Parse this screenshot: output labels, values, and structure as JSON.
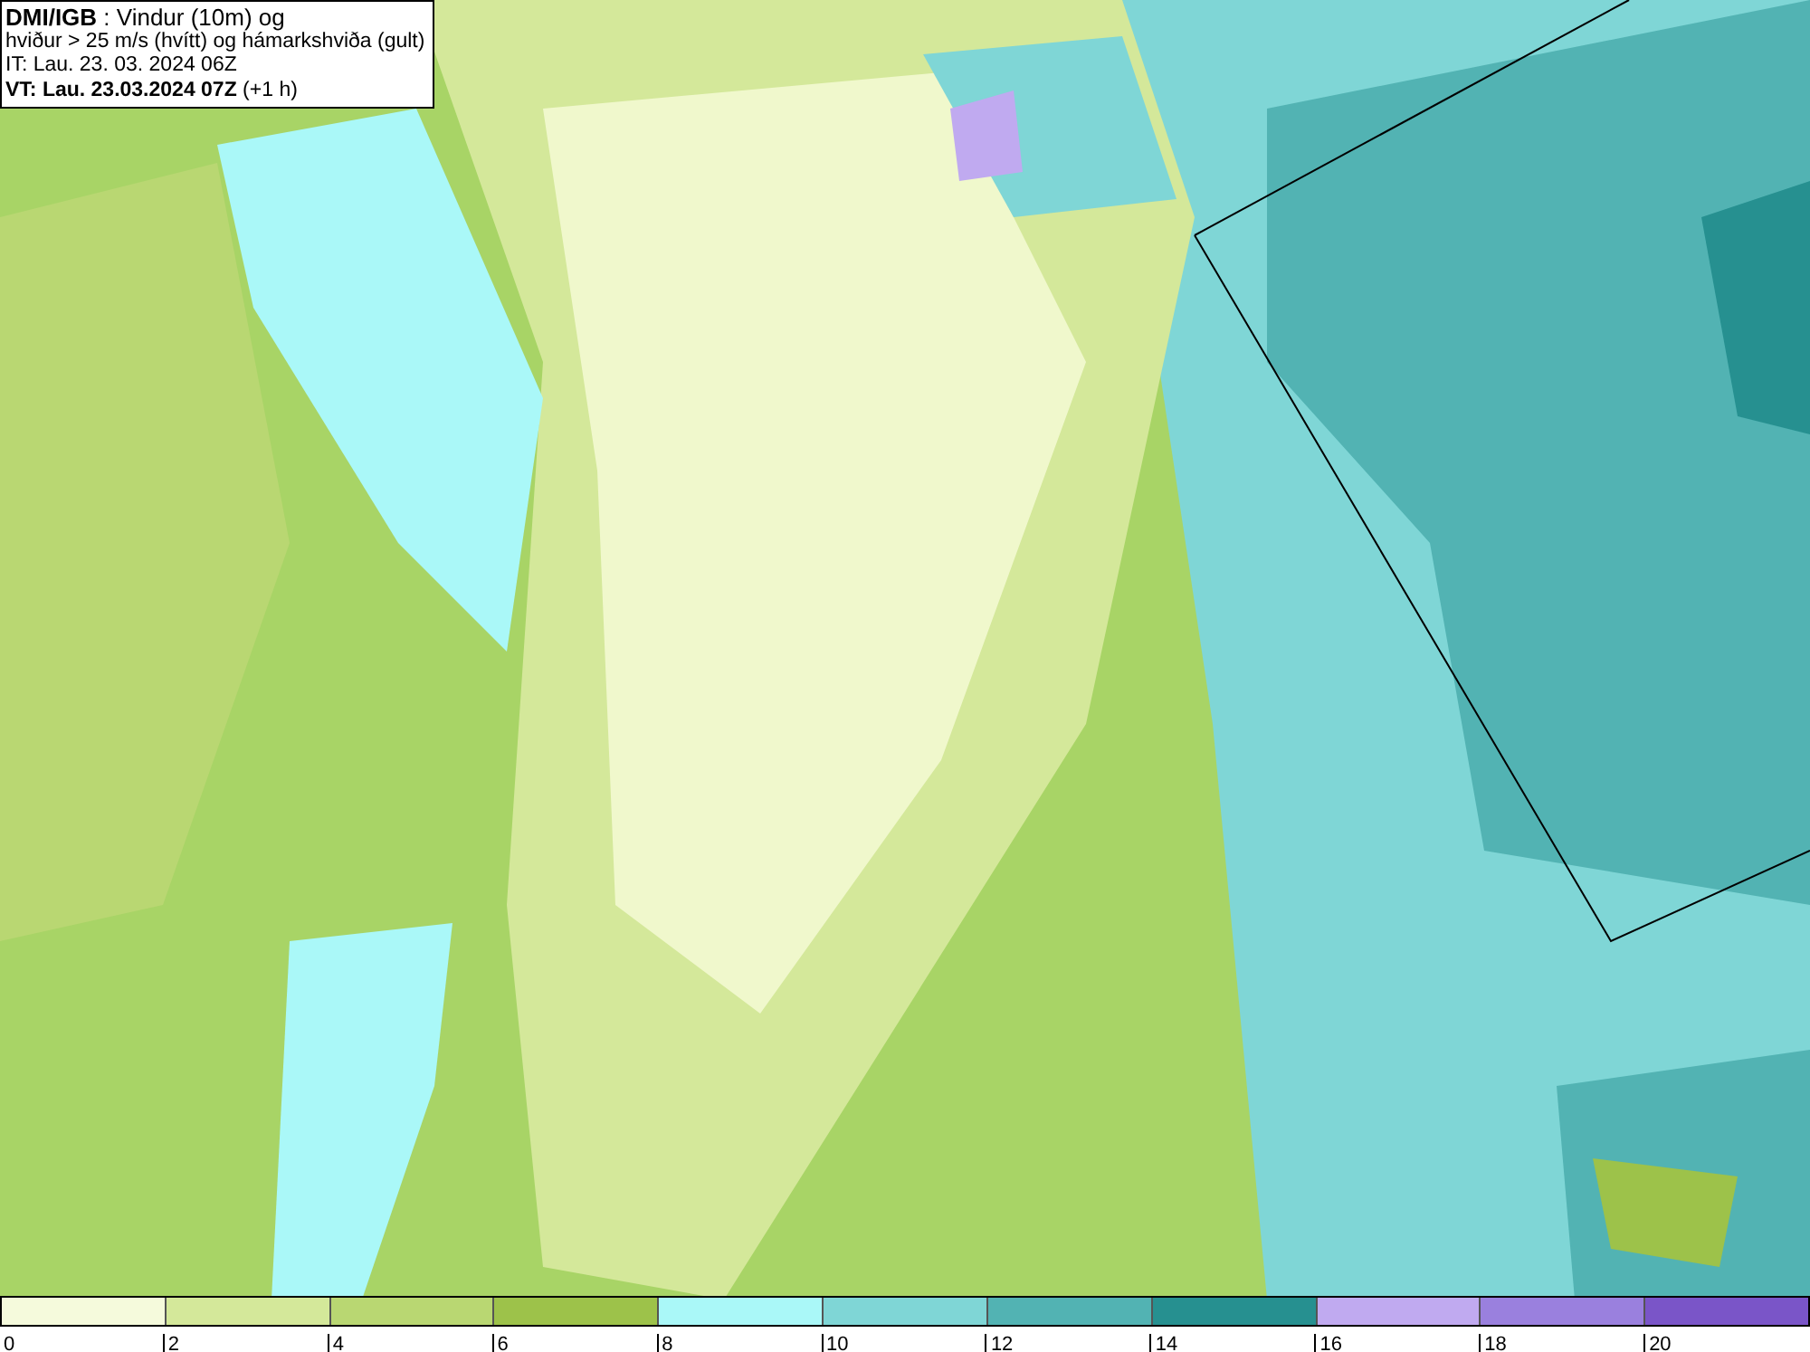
{
  "header": {
    "lines": [
      "**DMI/IGB** : Vindur (10m) og",
      "hviður > 25 m/s (hvítt) og hámarkshviða (gult)",
      "IT: Lau. 23. 03. 2024 06Z",
      "**VT: Lau. 23.03.2024 07Z** (+1 h)"
    ]
  },
  "legend": {
    "segments": [
      {
        "color": "#f5fadc",
        "label": "0"
      },
      {
        "color": "#d4e89a",
        "label": "2"
      },
      {
        "color": "#b9d772",
        "label": "4"
      },
      {
        "color": "#9dc24a",
        "label": "6"
      },
      {
        "color": "#aaf8f8",
        "label": "8"
      },
      {
        "color": "#7fd6d6",
        "label": "10"
      },
      {
        "color": "#52b3b3",
        "label": "12"
      },
      {
        "color": "#269090",
        "label": "14"
      },
      {
        "color": "#c0aaf0",
        "label": "16"
      },
      {
        "color": "#9a80de",
        "label": "18"
      },
      {
        "color": "#7a55c8",
        "label": "20"
      }
    ]
  }
}
